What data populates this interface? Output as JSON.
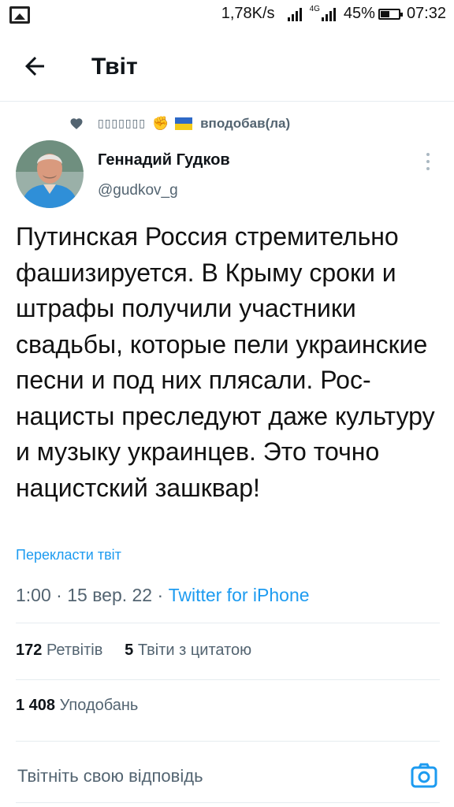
{
  "status_bar": {
    "speed": "1,78K/s",
    "network": "4G",
    "battery": "45%",
    "time": "07:32",
    "icons": [
      "image-icon",
      "signal-icon",
      "battery-icon"
    ]
  },
  "header": {
    "title": "Твіт",
    "back_icon": "arrow-left-icon"
  },
  "social_context": {
    "liked_by": "▯▯▯▯▯▯▯",
    "emoji_fist": "✊",
    "action": "вподобав(ла)",
    "icon": "heart-icon"
  },
  "tweet": {
    "author_name": "Геннадий Гудков",
    "author_handle": "@gudkov_g",
    "text": "Путинская Россия стремительно фашизируется. В Крыму сроки и штрафы получили участники свадьбы, которые пели украинские песни и под них плясали. Рос-нацисты преследуют даже культуру и музыку украинцев. Это точно нацистский зашквар!",
    "translate_label": "Перекласти твіт",
    "time": "1:00",
    "date": "15 вер. 22",
    "source": "Twitter for iPhone",
    "dot": "·"
  },
  "stats": {
    "retweets_count": "172",
    "retweets_label": "Ретвітів",
    "quotes_count": "5",
    "quotes_label": "Твіти з цитатою",
    "likes_count": "1 408",
    "likes_label": "Уподобань"
  },
  "reply": {
    "placeholder": "Твітніть свою відповідь",
    "camera_icon": "camera-icon"
  },
  "colors": {
    "accent": "#1d9bf0",
    "secondary_text": "#536471",
    "primary_text": "#0f1419",
    "divider": "#e6ecf0"
  }
}
